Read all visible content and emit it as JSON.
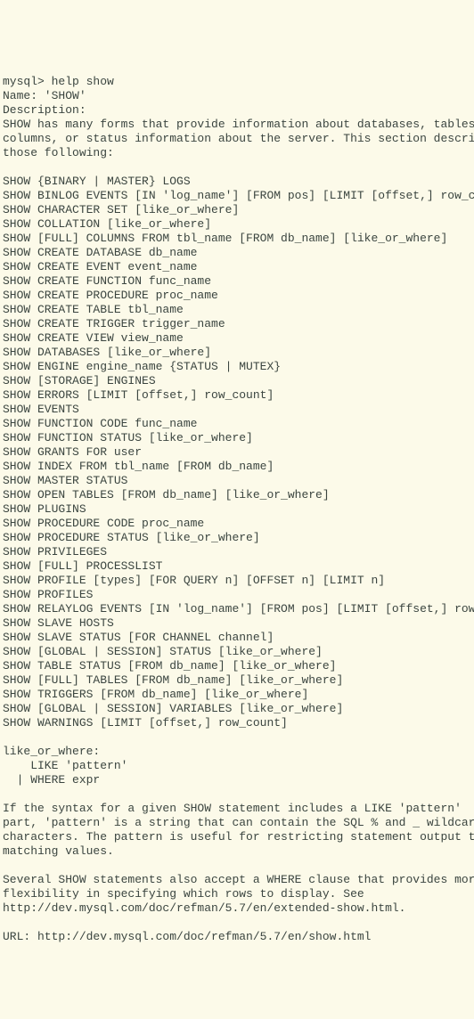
{
  "terminal": {
    "prompt": "mysql> help show",
    "name_label": "Name: 'SHOW'",
    "desc_label": "Description:",
    "desc_text1": "SHOW has many forms that provide information about databases, tables,",
    "desc_text2": "columns, or status information about the server. This section describes",
    "desc_text3": "those following:",
    "blank": "",
    "cmd01": "SHOW {BINARY | MASTER} LOGS",
    "cmd02": "SHOW BINLOG EVENTS [IN 'log_name'] [FROM pos] [LIMIT [offset,] row_count]",
    "cmd03": "SHOW CHARACTER SET [like_or_where]",
    "cmd04": "SHOW COLLATION [like_or_where]",
    "cmd05": "SHOW [FULL] COLUMNS FROM tbl_name [FROM db_name] [like_or_where]",
    "cmd06": "SHOW CREATE DATABASE db_name",
    "cmd07": "SHOW CREATE EVENT event_name",
    "cmd08": "SHOW CREATE FUNCTION func_name",
    "cmd09": "SHOW CREATE PROCEDURE proc_name",
    "cmd10": "SHOW CREATE TABLE tbl_name",
    "cmd11": "SHOW CREATE TRIGGER trigger_name",
    "cmd12": "SHOW CREATE VIEW view_name",
    "cmd13": "SHOW DATABASES [like_or_where]",
    "cmd14": "SHOW ENGINE engine_name {STATUS | MUTEX}",
    "cmd15": "SHOW [STORAGE] ENGINES",
    "cmd16": "SHOW ERRORS [LIMIT [offset,] row_count]",
    "cmd17": "SHOW EVENTS",
    "cmd18": "SHOW FUNCTION CODE func_name",
    "cmd19": "SHOW FUNCTION STATUS [like_or_where]",
    "cmd20": "SHOW GRANTS FOR user",
    "cmd21": "SHOW INDEX FROM tbl_name [FROM db_name]",
    "cmd22": "SHOW MASTER STATUS",
    "cmd23": "SHOW OPEN TABLES [FROM db_name] [like_or_where]",
    "cmd24": "SHOW PLUGINS",
    "cmd25": "SHOW PROCEDURE CODE proc_name",
    "cmd26": "SHOW PROCEDURE STATUS [like_or_where]",
    "cmd27": "SHOW PRIVILEGES",
    "cmd28": "SHOW [FULL] PROCESSLIST",
    "cmd29": "SHOW PROFILE [types] [FOR QUERY n] [OFFSET n] [LIMIT n]",
    "cmd30": "SHOW PROFILES",
    "cmd31": "SHOW RELAYLOG EVENTS [IN 'log_name'] [FROM pos] [LIMIT [offset,] row_count]",
    "cmd32": "SHOW SLAVE HOSTS",
    "cmd33": "SHOW SLAVE STATUS [FOR CHANNEL channel]",
    "cmd34": "SHOW [GLOBAL | SESSION] STATUS [like_or_where]",
    "cmd35": "SHOW TABLE STATUS [FROM db_name] [like_or_where]",
    "cmd36": "SHOW [FULL] TABLES [FROM db_name] [like_or_where]",
    "cmd37": "SHOW TRIGGERS [FROM db_name] [like_or_where]",
    "cmd38": "SHOW [GLOBAL | SESSION] VARIABLES [like_or_where]",
    "cmd39": "SHOW WARNINGS [LIMIT [offset,] row_count]",
    "like_header": "like_or_where:",
    "like_opt1": "    LIKE 'pattern'",
    "like_opt2": "  | WHERE expr",
    "note1": "If the syntax for a given SHOW statement includes a LIKE 'pattern'",
    "note2": "part, 'pattern' is a string that can contain the SQL % and _ wildcard",
    "note3": "characters. The pattern is useful for restricting statement output to",
    "note4": "matching values.",
    "note5": "Several SHOW statements also accept a WHERE clause that provides more",
    "note6": "flexibility in specifying which rows to display. See",
    "note7": "http://dev.mysql.com/doc/refman/5.7/en/extended-show.html.",
    "url_line": "URL: http://dev.mysql.com/doc/refman/5.7/en/show.html"
  }
}
